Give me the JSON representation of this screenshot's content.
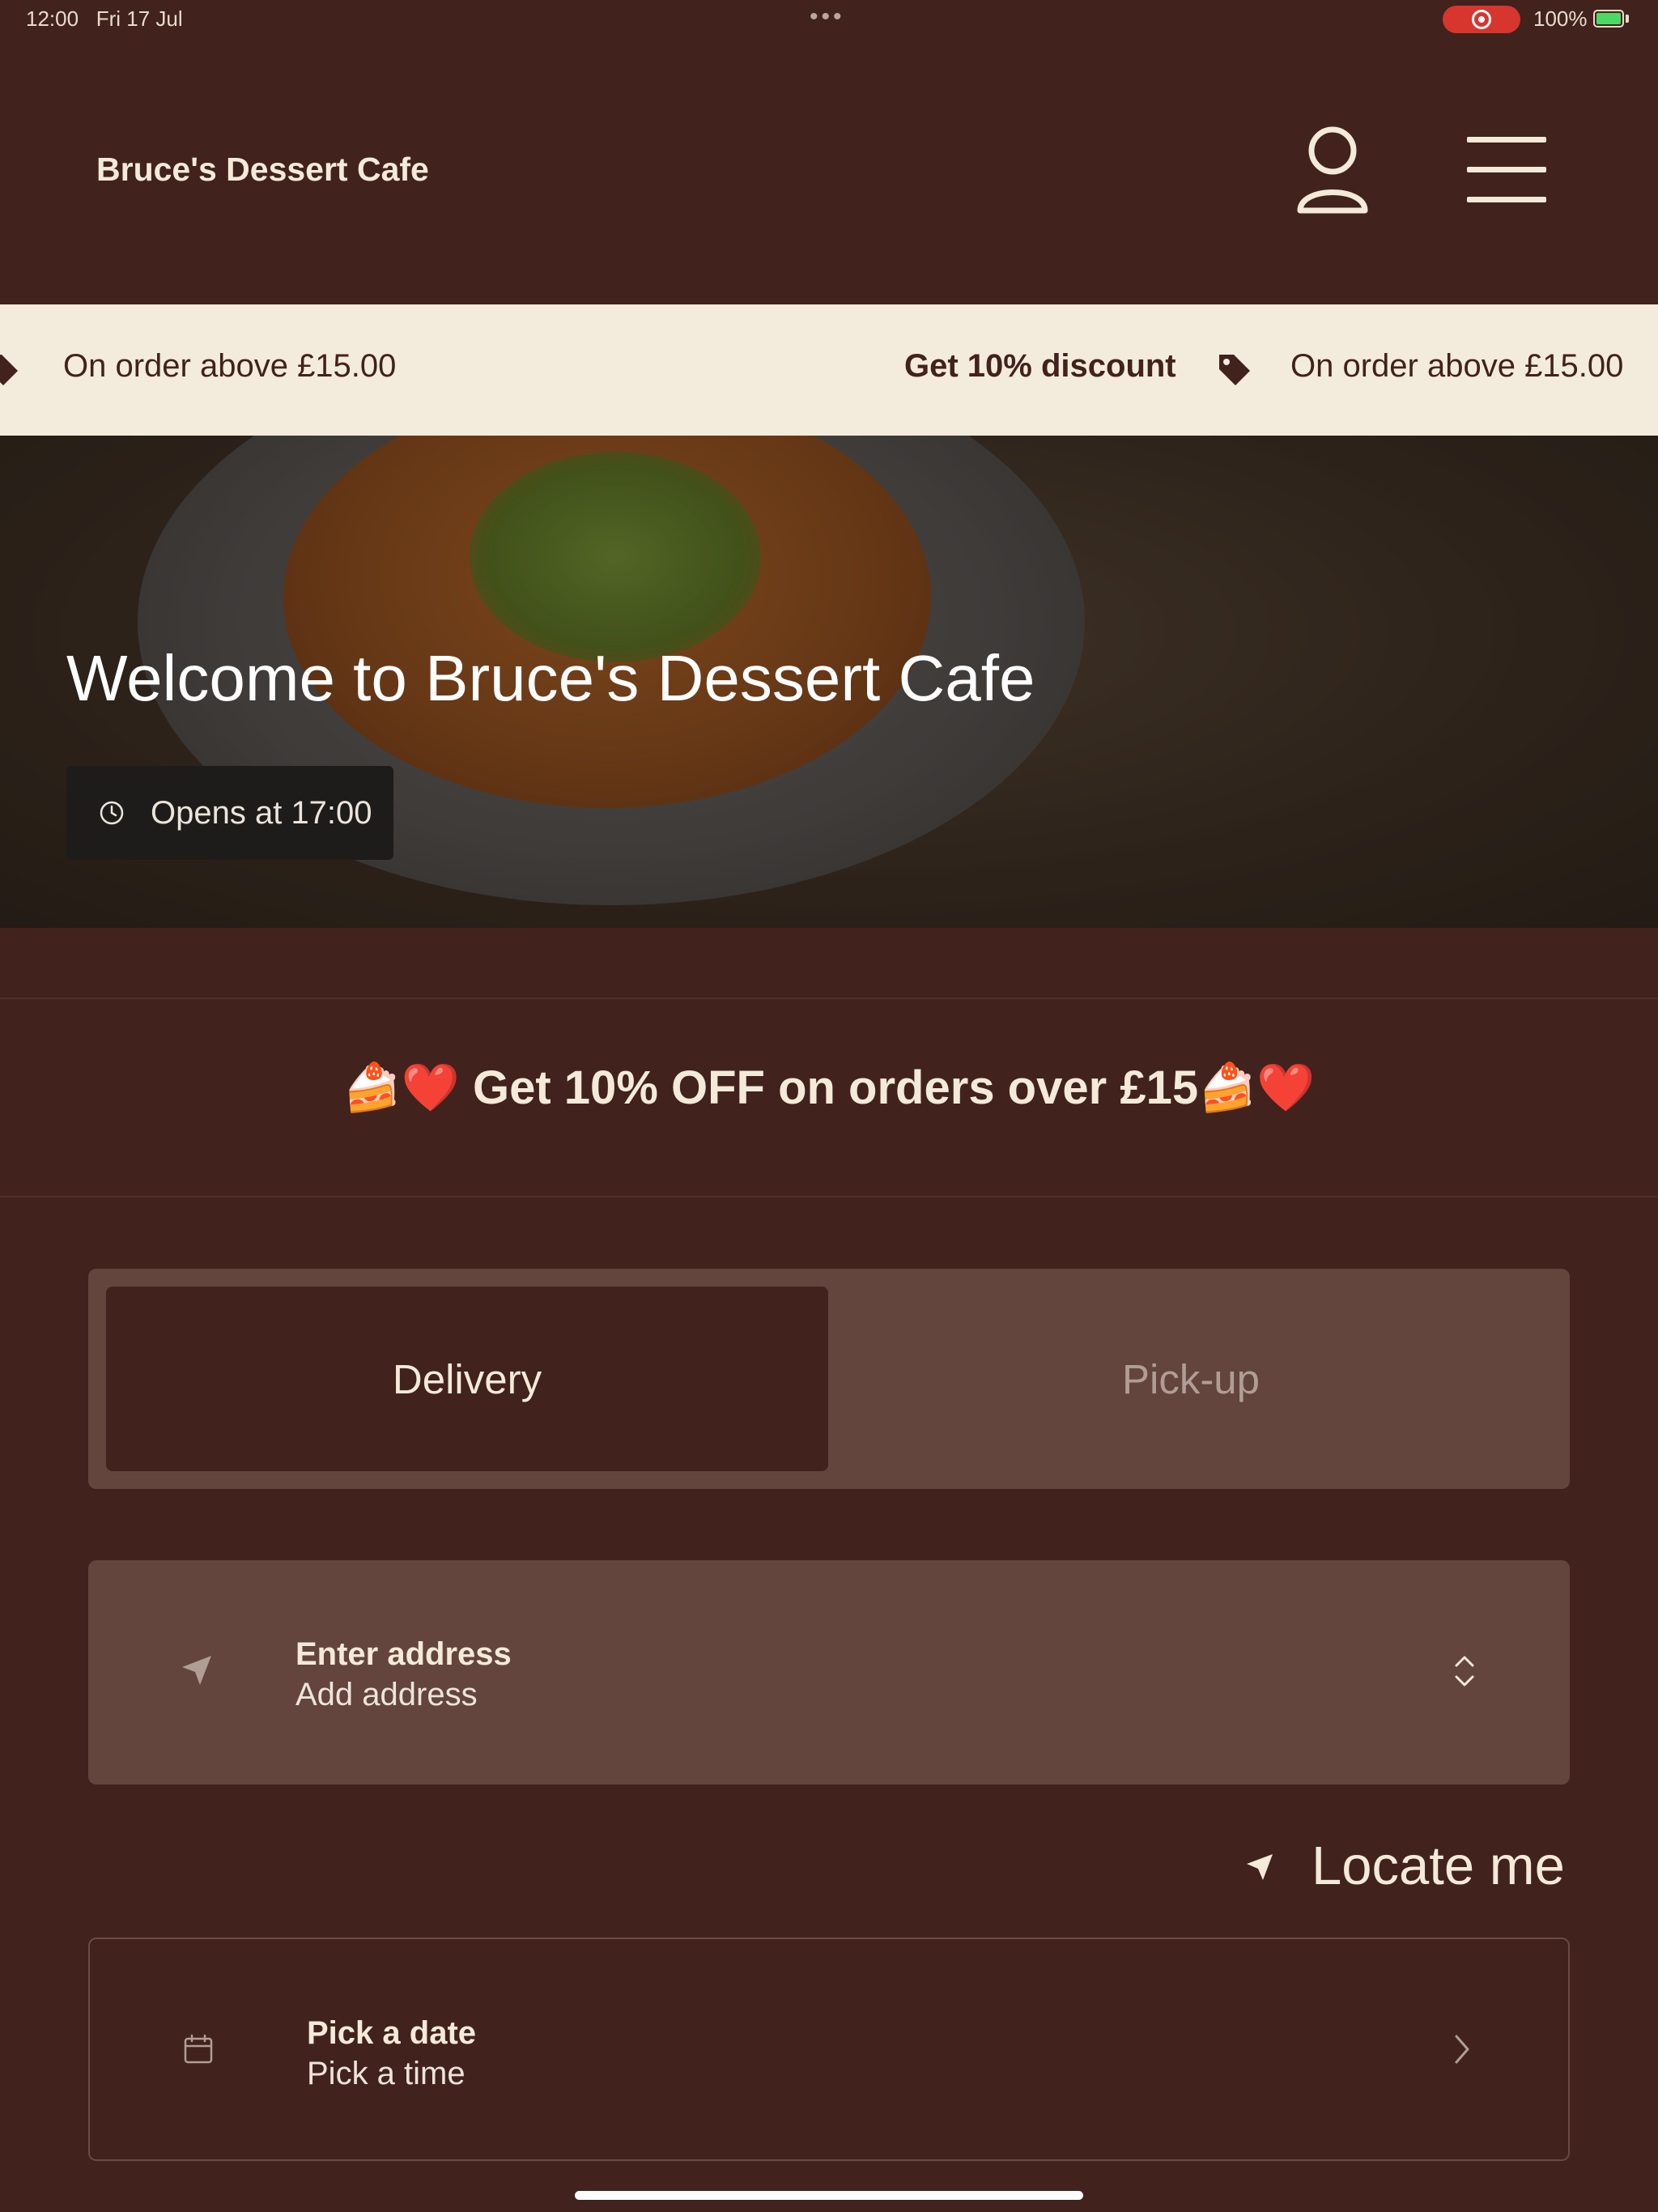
{
  "status_bar": {
    "time": "12:00",
    "date": "Fri 17 Jul",
    "dots": "•••",
    "battery": "100%"
  },
  "header": {
    "brand": "Bruce's Dessert Cafe"
  },
  "promo_strip": {
    "items": [
      {
        "text": "On order above £15.00"
      },
      {
        "text": "Get 10% discount"
      },
      {
        "text": "On order above £15.00"
      }
    ]
  },
  "hero": {
    "title": "Welcome to Bruce's Dessert Cafe",
    "opens": "Opens at 17:00"
  },
  "offer_banner": "🍰❤️ Get 10% OFF on orders over £15🍰❤️",
  "order_type": {
    "options": [
      "Delivery",
      "Pick-up"
    ],
    "selected": "Delivery"
  },
  "address": {
    "title": "Enter address",
    "subtitle": "Add address"
  },
  "locate": {
    "label": "Locate me"
  },
  "schedule": {
    "title": "Pick a date",
    "subtitle": "Pick a time"
  },
  "colors": {
    "background": "#42221d",
    "strip": "#f3ecdc",
    "card": "#63453e",
    "text": "#f3ead9",
    "recording": "#d6362e"
  },
  "icons": [
    "profile-icon",
    "menu-icon",
    "tag-icon",
    "clock-icon",
    "location-arrow-icon",
    "chevron-up-down-icon",
    "calendar-icon",
    "chevron-right-icon"
  ]
}
